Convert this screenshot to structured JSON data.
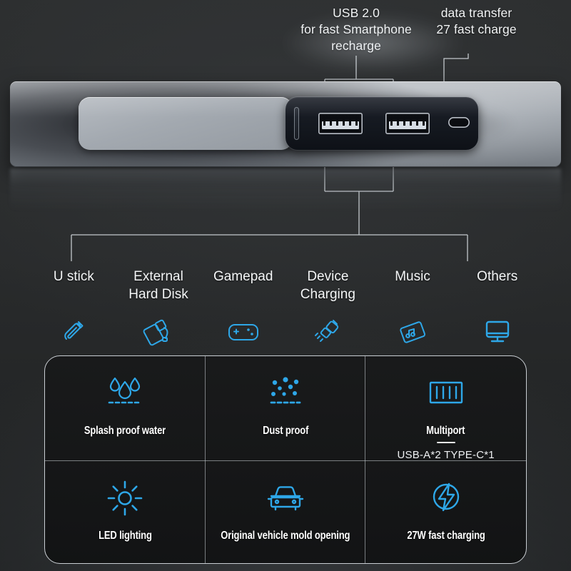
{
  "background_color": "#2b2d2e",
  "accent_color": "#2ea7e8",
  "callouts": {
    "usb_ports": "USB 2.0\nfor fast Smartphone\nrecharge",
    "type_c": "data transfer\n27 fast charge"
  },
  "device": {
    "name": "car-usb-hub",
    "ports": {
      "usb_a_1": "USB-A port",
      "usb_a_2": "USB-A port",
      "usb_c": "USB-C port",
      "slot": "thin slot"
    }
  },
  "use_cases": [
    {
      "label": "U stick",
      "icon": "usb-flash-drive-icon"
    },
    {
      "label": "External\nHard Disk",
      "icon": "hard-disk-icon"
    },
    {
      "label": "Gamepad",
      "icon": "gamepad-icon"
    },
    {
      "label": "Device\nCharging",
      "icon": "charging-cable-icon"
    },
    {
      "label": "Music",
      "icon": "music-device-icon"
    },
    {
      "label": "Others",
      "icon": "monitor-icon"
    }
  ],
  "features": [
    {
      "label": "Splash proof water",
      "icon": "water-drops-icon",
      "sub": ""
    },
    {
      "label": "Dust proof",
      "icon": "dust-particles-icon",
      "sub": ""
    },
    {
      "label": "Multiport",
      "icon": "ports-icon",
      "sub": "USB-A*2  TYPE-C*1"
    },
    {
      "label": "LED lighting",
      "icon": "sun-icon",
      "sub": ""
    },
    {
      "label": "Original vehicle mold opening",
      "icon": "car-icon",
      "sub": ""
    },
    {
      "label": "27W fast charging",
      "icon": "lightning-bolt-icon",
      "sub": ""
    }
  ]
}
